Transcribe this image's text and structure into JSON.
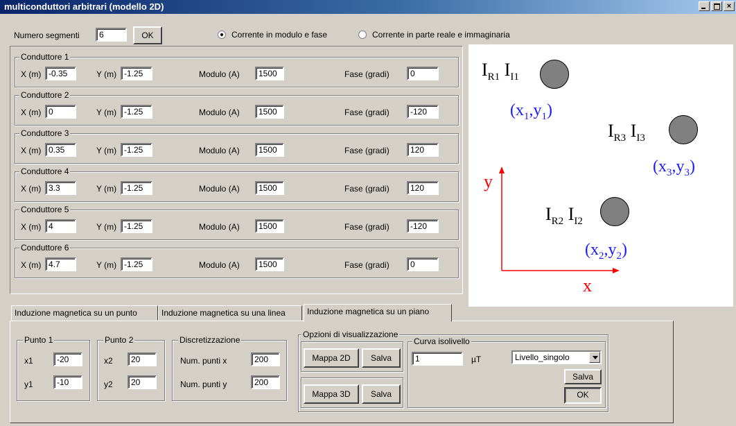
{
  "window": {
    "title": "multiconduttori arbitrari (modello 2D)",
    "close_glyph": "×"
  },
  "top": {
    "segments_label": "Numero segmenti",
    "segments_value": "6",
    "ok_label": "OK",
    "radio1_label": "Corrente in modulo e fase",
    "radio2_label": "Corrente in parte reale e immaginaria"
  },
  "conductor_labels": {
    "x": "X (m)",
    "y": "Y (m)",
    "modulo": "Modulo (A)",
    "fase": "Fase (gradi)"
  },
  "conductors": [
    {
      "title": "Conduttore 1",
      "x": "-0.35",
      "y": "-1.25",
      "modulo": "1500",
      "fase": "0"
    },
    {
      "title": "Conduttore 2",
      "x": "0",
      "y": "-1.25",
      "modulo": "1500",
      "fase": "-120"
    },
    {
      "title": "Conduttore 3",
      "x": "0.35",
      "y": "-1.25",
      "modulo": "1500",
      "fase": "120"
    },
    {
      "title": "Conduttore 4",
      "x": "3.3",
      "y": "-1.25",
      "modulo": "1500",
      "fase": "120"
    },
    {
      "title": "Conduttore 5",
      "x": "4",
      "y": "-1.25",
      "modulo": "1500",
      "fase": "-120"
    },
    {
      "title": "Conduttore 6",
      "x": "4.7",
      "y": "-1.25",
      "modulo": "1500",
      "fase": "0"
    }
  ],
  "diagram": {
    "c1": {
      "ir": "R1",
      "ii": "I1",
      "xs": "1",
      "ys": "1"
    },
    "c3": {
      "ir": "R3",
      "ii": "I3",
      "xs": "3",
      "ys": "3"
    },
    "c2": {
      "ir": "R2",
      "ii": "I2",
      "xs": "2",
      "ys": "2"
    },
    "y_axis": "y",
    "x_axis": "x",
    "colors": {
      "axis": "#ff0000",
      "coords": "#1a1aff",
      "circle": "#808080"
    }
  },
  "tabs": [
    {
      "label": "Induzione magnetica su un punto"
    },
    {
      "label": "Induzione magnetica su una linea"
    },
    {
      "label": "Induzione magnetica su un piano"
    }
  ],
  "plane": {
    "punto1": {
      "title": "Punto 1",
      "x1_label": "x1",
      "x1": "-20",
      "y1_label": "y1",
      "y1": "-10"
    },
    "punto2": {
      "title": "Punto 2",
      "x2_label": "x2",
      "x2": "20",
      "y2_label": "y2",
      "y2": "20"
    },
    "disc": {
      "title": "Discretizzazione",
      "nx_label": "Num. punti x",
      "nx": "200",
      "ny_label": "Num. punti y",
      "ny": "200"
    },
    "opzioni": {
      "title": "Opzioni di visualizzazione",
      "mappa2d": "Mappa 2D",
      "salva1": "Salva",
      "mappa3d": "Mappa 3D",
      "salva2": "Salva"
    },
    "curva": {
      "title": "Curva isolivello",
      "value": "1",
      "unit": "µT",
      "select": "Livello_singolo",
      "salva": "Salva",
      "ok": "OK"
    }
  }
}
